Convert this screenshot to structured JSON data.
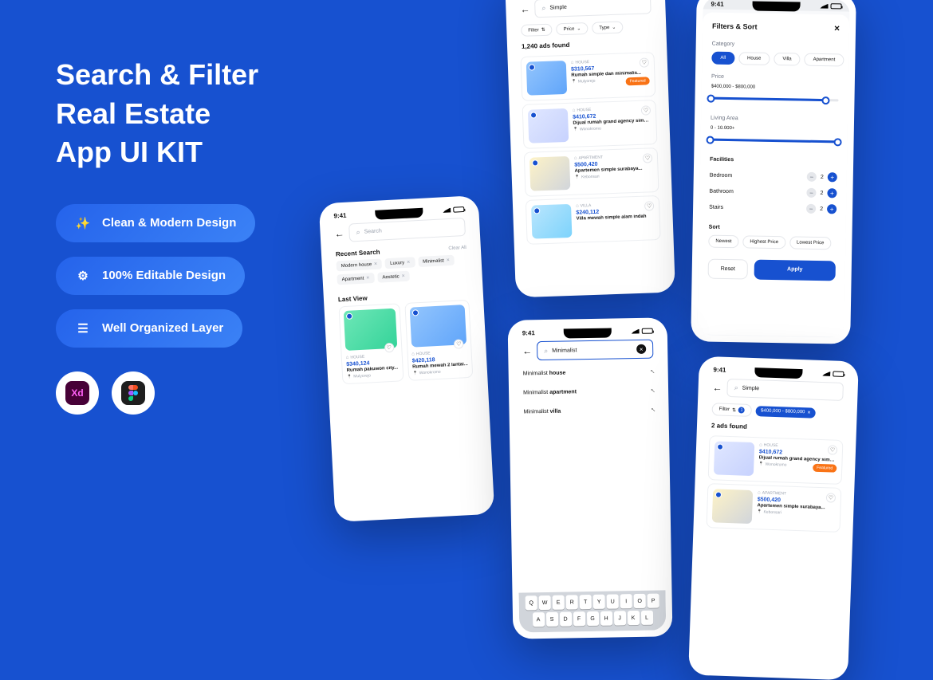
{
  "promo": {
    "title_line1": "Search & Filter",
    "title_line2": "Real Estate",
    "title_line3": "App UI KIT",
    "features": [
      "Clean & Modern Design",
      "100% Editable Design",
      "Well Organized Layer"
    ]
  },
  "common": {
    "time": "9:41"
  },
  "phone_search": {
    "placeholder": "Search",
    "recent_title": "Recent Search",
    "clear_all": "Clear All",
    "recent_chips": [
      "Modern house",
      "Luxury",
      "Minimalist",
      "Apartment",
      "Aestetic"
    ],
    "last_view_title": "Last View",
    "cards": [
      {
        "cat": "HOUSE",
        "price": "$340,124",
        "desc": "Rumah pakuwon city...",
        "loc": "Mulyorejo"
      },
      {
        "cat": "HOUSE",
        "price": "$420,118",
        "desc": "Rumah mewah 2 lantai...",
        "loc": "Wonokromo"
      }
    ]
  },
  "phone_results": {
    "query": "Simple",
    "filter_label": "Filter",
    "price_label": "Price",
    "type_label": "Type",
    "count": "1,240 ads found",
    "listings": [
      {
        "cat": "HOUSE",
        "price": "$310,567",
        "desc": "Rumah simple dan minimalis...",
        "loc": "Mulyorejo",
        "featured": "Featured"
      },
      {
        "cat": "HOUSE",
        "price": "$410,672",
        "desc": "Dijual rumah grand agency simpl...",
        "loc": "Wonokromo"
      },
      {
        "cat": "APARTMENT",
        "price": "$500,420",
        "desc": "Apartemen simple surabaya...",
        "loc": "Kebonsari"
      },
      {
        "cat": "VILLA",
        "price": "$240,112",
        "desc": "Villa mewah simple alam indah"
      }
    ]
  },
  "phone_filters": {
    "title": "Filters & Sort",
    "category_label": "Category",
    "categories": [
      "All",
      "House",
      "Villa",
      "Apartment"
    ],
    "price_label": "Price",
    "price_range": "$400,000 - $800,000",
    "area_label": "Living Area",
    "area_range": "0 - 10.000+",
    "facilities_label": "Facilities",
    "facilities": [
      {
        "name": "Bedroom",
        "value": "2"
      },
      {
        "name": "Bathroom",
        "value": "2"
      },
      {
        "name": "Stairs",
        "value": "2"
      }
    ],
    "sort_label": "Sort",
    "sort_options": [
      "Newest",
      "Highest Price",
      "Lowest Price"
    ],
    "reset": "Reset",
    "apply": "Apply"
  },
  "phone_suggest": {
    "query": "Minimalist",
    "suggestions": [
      {
        "pre": "Minimalist ",
        "bold": "house"
      },
      {
        "pre": "Minimalist ",
        "bold": "apartment"
      },
      {
        "pre": "Minimalist ",
        "bold": "villa"
      }
    ],
    "keyboard": [
      [
        "Q",
        "W",
        "E",
        "R",
        "T",
        "Y",
        "U",
        "I",
        "O",
        "P"
      ],
      [
        "A",
        "S",
        "D",
        "F",
        "G",
        "H",
        "J",
        "K",
        "L"
      ]
    ]
  },
  "phone_filtered": {
    "query": "Simple",
    "filter_label": "Filter",
    "filter_count": "1",
    "active_chip": "$400,000 - $800,000",
    "count": "2 ads found",
    "listings": [
      {
        "cat": "HOUSE",
        "price": "$410,672",
        "desc": "Dijual rumah grand agency simpl...",
        "loc": "Wonokromo",
        "featured": "Featured"
      },
      {
        "cat": "APARTMENT",
        "price": "$500,420",
        "desc": "Apartemen simple surabaya...",
        "loc": "Kebonsari"
      }
    ]
  }
}
